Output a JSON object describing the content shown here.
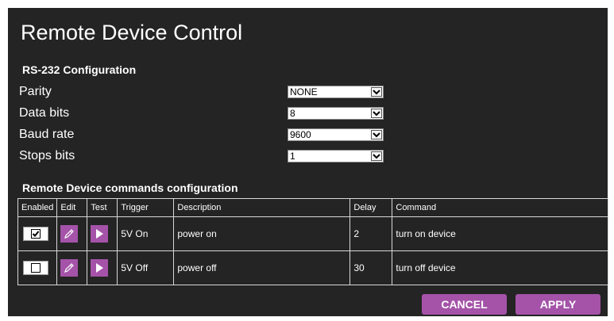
{
  "page": {
    "title": "Remote Device Control"
  },
  "rs232": {
    "section_title": "RS-232 Configuration",
    "rows": [
      {
        "label": "Parity",
        "value": "NONE"
      },
      {
        "label": "Data bits",
        "value": "8"
      },
      {
        "label": "Baud rate",
        "value": "9600"
      },
      {
        "label": "Stops bits",
        "value": "1"
      }
    ]
  },
  "commands": {
    "section_title": "Remote Device commands configuration",
    "headers": [
      "Enabled",
      "Edit",
      "Test",
      "Trigger",
      "Description",
      "Delay",
      "Command"
    ],
    "rows": [
      {
        "enabled": true,
        "trigger": "5V On",
        "description": "power on",
        "delay": "2",
        "command": "turn on device"
      },
      {
        "enabled": false,
        "trigger": "5V Off",
        "description": "power off",
        "delay": "30",
        "command": "turn off device"
      }
    ]
  },
  "buttons": {
    "cancel": "CANCEL",
    "apply": "APPLY"
  },
  "colors": {
    "panel_bg": "#242424",
    "accent": "#a453a8",
    "border": "#d8d8d8"
  },
  "icons": {
    "edit": "pencil-icon",
    "test": "play-icon",
    "dropdown": "chevron-down-icon",
    "check": "checkmark-icon"
  }
}
